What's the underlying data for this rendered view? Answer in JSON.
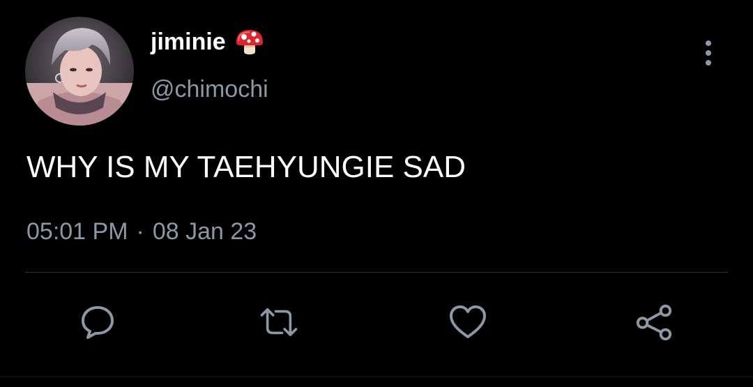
{
  "tweet": {
    "author": {
      "display_name": "jiminie",
      "handle": "@chimochi",
      "emoji_icon": "mushroom-icon"
    },
    "text": "WHY IS MY TAEHYUNGIE SAD",
    "time": "05:01 PM",
    "separator": "·",
    "date": "08 Jan 23"
  },
  "actions": [
    {
      "name": "reply",
      "icon": "speech-bubble-icon"
    },
    {
      "name": "retweet",
      "icon": "retweet-icon"
    },
    {
      "name": "like",
      "icon": "heart-icon"
    },
    {
      "name": "share",
      "icon": "share-icon"
    }
  ],
  "colors": {
    "background": "#000000",
    "primary_text": "#ffffff",
    "secondary_text": "#8b98a5",
    "icon": "#8b98a5",
    "divider": "#2f3336"
  }
}
